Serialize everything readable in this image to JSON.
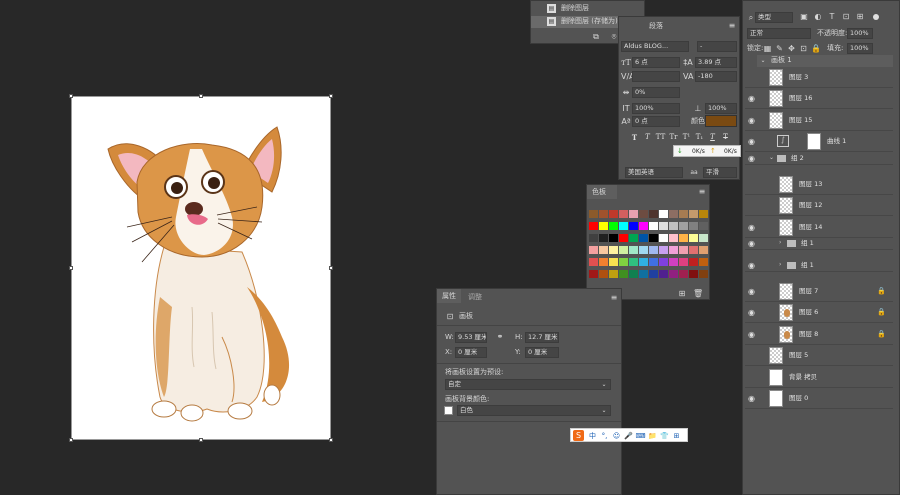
{
  "history": {
    "items": [
      "删除图层",
      "删除图层 (存储为)"
    ]
  },
  "character": {
    "tab_partial": "段落",
    "font_family": "Aldus BLOG...",
    "font_style": "-",
    "font_size": "6 点",
    "leading": "3.89 点",
    "kerning": "",
    "tracking": "-180",
    "tsume": "0%",
    "vscale": "100%",
    "hscale": "100%",
    "baseline": "0 点",
    "color_label": "颜色:",
    "color_value": "#7a4a12",
    "language": "美国英语",
    "aa_icon": "aa",
    "antialias": "平滑",
    "net_down": "0K/s",
    "net_up": "0K/s",
    "text_buttons": [
      "T",
      "T",
      "TT",
      "Tr",
      "T¹",
      "T₁",
      "T",
      "T"
    ]
  },
  "swatches": {
    "title": "色板",
    "colors": [
      [
        "#8b5a2b",
        "#a0522d",
        "#c0392b",
        "#d35f5f",
        "#e8a0b0",
        "#6d4c41",
        "#4e342e",
        "#ffffff",
        "#8d6e63",
        "#a67c52",
        "#c49a6c",
        "#b8860b"
      ],
      [
        "#ff0000",
        "#ffff00",
        "#00ff00",
        "#00ffff",
        "#0000ff",
        "#ff00ff",
        "#ffffff",
        "#e0e0e0",
        "#c0c0c0",
        "#a0a0a0",
        "#808080",
        "#606060"
      ],
      [
        "#404040",
        "#202020",
        "#000000",
        "#ff0000",
        "#00a651",
        "#0054a6",
        "#000000",
        "#ffffff",
        "#ffc0cb",
        "#ffb347",
        "#fdfd96",
        "#c8e6c9"
      ],
      [
        "#f4a0a0",
        "#f8c8a0",
        "#fff2a0",
        "#d0f0a0",
        "#a0e8c8",
        "#a0d8f0",
        "#a0b8f0",
        "#c8a0f0",
        "#f0a0d8",
        "#f0a0b0",
        "#e07070",
        "#e0a070"
      ],
      [
        "#e05050",
        "#f08030",
        "#f8e050",
        "#80d040",
        "#30c080",
        "#30b0e0",
        "#4070e0",
        "#8040e0",
        "#d040c0",
        "#e04080",
        "#c02020",
        "#c06010"
      ],
      [
        "#a01818",
        "#b05010",
        "#c0a010",
        "#409020",
        "#108050",
        "#1070a0",
        "#2040a0",
        "#502090",
        "#902080",
        "#a02050",
        "#801010",
        "#804010"
      ]
    ]
  },
  "properties": {
    "tabs": [
      "属性",
      "调整"
    ],
    "doc_type": "画板",
    "w_label": "W:",
    "w_value": "9.53 厘米",
    "h_label": "H:",
    "h_value": "12.7 厘米",
    "x_label": "X:",
    "x_value": "0 厘米",
    "y_label": "Y:",
    "y_value": "0 厘米",
    "preset_label": "将画板设置为预设:",
    "preset_value": "自定",
    "bg_label": "画板背景颜色:",
    "bg_value": "白色"
  },
  "ime_toolbar": {
    "logo": "S",
    "items": [
      "中",
      "°,",
      "☺",
      "🎤",
      "⌨",
      "📁",
      "👕",
      "⊞"
    ]
  },
  "layers": {
    "filter_label": "类型",
    "blend_mode": "正常",
    "opacity_label": "不透明度:",
    "opacity": "100%",
    "lock_label": "锁定:",
    "fill_label": "填充:",
    "fill": "100%",
    "artboard": "画板 1",
    "rows": [
      {
        "name": "图层 3",
        "type": "checker",
        "indent": 0,
        "eye": false,
        "lock": false
      },
      {
        "name": "图层 16",
        "type": "checker",
        "indent": 0,
        "eye": true,
        "lock": false
      },
      {
        "name": "图层 15",
        "type": "checker",
        "indent": 0,
        "eye": true,
        "lock": false
      },
      {
        "name": "曲线 1",
        "type": "adjust",
        "indent": 0,
        "eye": true,
        "lock": false
      },
      {
        "name": "组 2",
        "type": "group",
        "indent": 0,
        "eye": true,
        "lock": false
      },
      {
        "name": "图层 13",
        "type": "checker",
        "indent": 1,
        "eye": false,
        "lock": false
      },
      {
        "name": "图层 12",
        "type": "checker",
        "indent": 1,
        "eye": false,
        "lock": false
      },
      {
        "name": "图层 14",
        "type": "checker",
        "indent": 1,
        "eye": true,
        "lock": false
      },
      {
        "name": "组 1",
        "type": "group",
        "indent": 1,
        "eye": true,
        "lock": false
      },
      {
        "name": "组 1",
        "type": "group",
        "indent": 1,
        "eye": true,
        "lock": false
      },
      {
        "name": "图层 7",
        "type": "checker",
        "indent": 1,
        "eye": true,
        "lock": true
      },
      {
        "name": "图层 6",
        "type": "dog",
        "indent": 1,
        "eye": true,
        "lock": true
      },
      {
        "name": "图层 8",
        "type": "dog",
        "indent": 1,
        "eye": true,
        "lock": true
      },
      {
        "name": "图层 5",
        "type": "checker",
        "indent": 0,
        "eye": false,
        "lock": false
      },
      {
        "name": "背景 拷贝",
        "type": "white",
        "indent": 0,
        "eye": false,
        "lock": false
      },
      {
        "name": "图层 0",
        "type": "white",
        "indent": 0,
        "eye": true,
        "lock": false
      }
    ]
  }
}
